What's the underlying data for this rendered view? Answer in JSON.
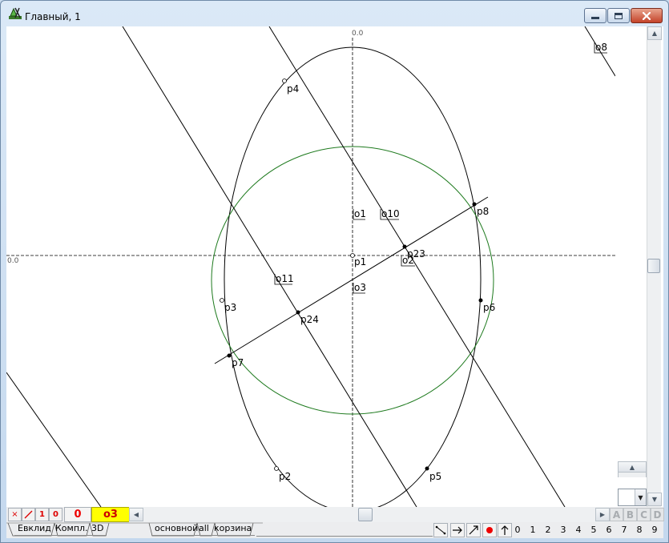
{
  "window": {
    "title": "Главный, 1"
  },
  "canvas": {
    "axis_origin_top": "0.0",
    "axis_origin_left": "0.0",
    "labels": {
      "p1": "p1",
      "p2": "p2",
      "p3": "p3",
      "p4": "p4",
      "p5": "p5",
      "p6": "p6",
      "p7": "p7",
      "p8": "p8",
      "p23": "p23",
      "p24": "p24",
      "o1": "o1",
      "o2": "o2",
      "o3": "o3",
      "o8": "o8",
      "o10": "o10",
      "o11": "o11"
    }
  },
  "toolbar1": {
    "btn_x": "×",
    "btn_1": "1",
    "btn_0": "0",
    "count": "0",
    "selected": "o3",
    "abcd": [
      "A",
      "B",
      "C",
      "D"
    ]
  },
  "toolbar2": {
    "tabs_left": [
      "Евклид",
      "Компл.",
      "3D"
    ],
    "tabs_right": [
      "основной",
      "all",
      "корзина"
    ],
    "digits": [
      "0",
      "1",
      "2",
      "3",
      "4",
      "5",
      "6",
      "7",
      "8",
      "9"
    ]
  },
  "colors": {
    "circle": "#1e7a1e",
    "ellipse": "#000000",
    "selection": "#ffff00",
    "count": "#e00000"
  },
  "icons": {
    "app": "geometry-app-icon",
    "minimize": "minimize-icon",
    "maximize": "maximize-icon",
    "close": "close-icon"
  }
}
